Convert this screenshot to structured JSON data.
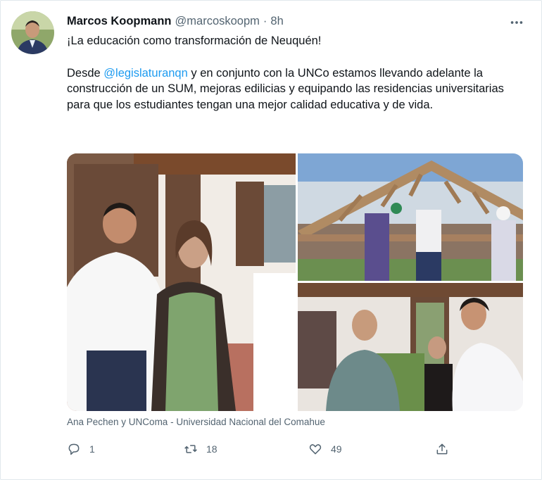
{
  "tweet": {
    "author_name": "Marcos Koopmann",
    "author_handle": "@marcoskoopm",
    "separator": "·",
    "time": "8h",
    "text_line1": "¡La educación como transformación de Neuquén!",
    "text_p2_before": "Desde ",
    "mention": "@legislaturanqn",
    "text_p2_after": " y en conjunto con la UNCo estamos llevando adelante la construcción de un SUM, mejoras edilicias y equipando las residencias universitarias para que los estudiantes tengan una mejor calidad educativa y de vida.",
    "media_caption": "Ana Pechen y UNComa - Universidad Nacional del Comahue",
    "reply_count": "1",
    "retweet_count": "18",
    "like_count": "49"
  },
  "icons": {
    "more": "more-icon",
    "reply": "reply-icon",
    "retweet": "retweet-icon",
    "like": "heart-icon",
    "share": "share-icon"
  },
  "colors": {
    "mention": "#1d9bf0",
    "secondary_text": "#536471",
    "primary_text": "#0f1419"
  }
}
